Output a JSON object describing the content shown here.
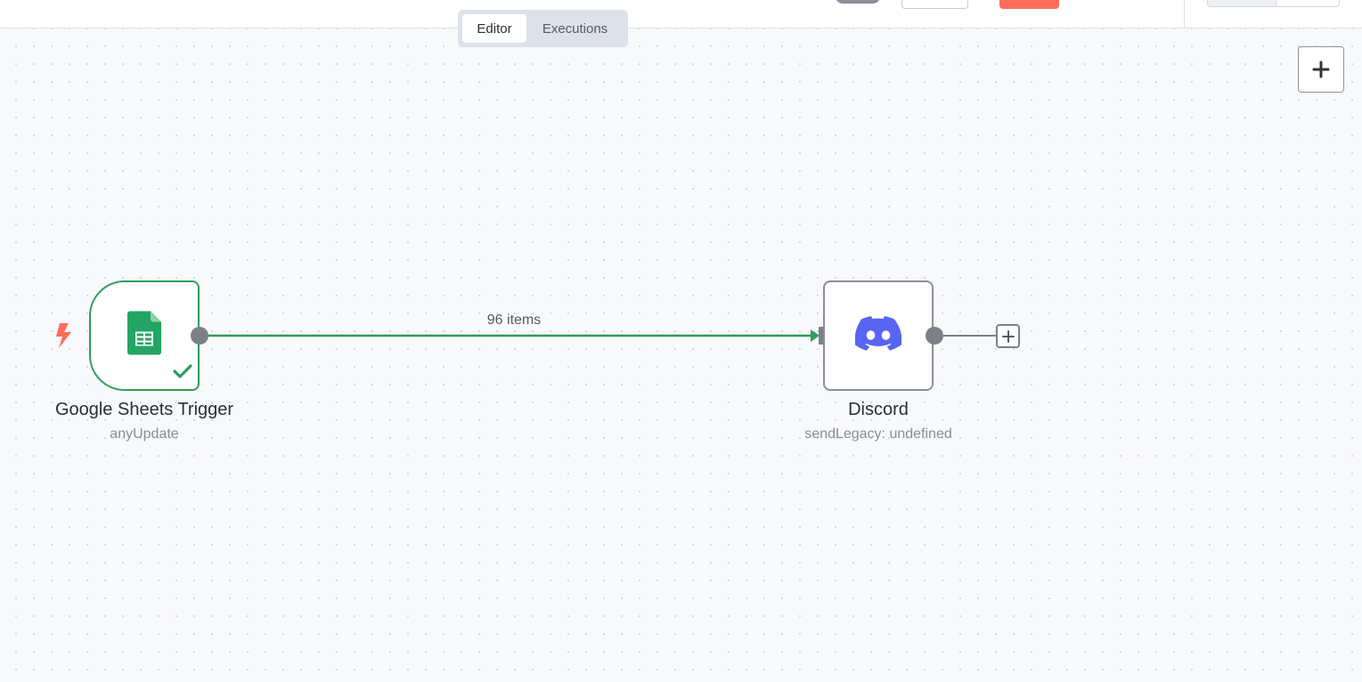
{
  "mode_toggle": {
    "editor_label": "Editor",
    "executions_label": "Executions",
    "active": "Editor"
  },
  "workflow": {
    "nodes": [
      {
        "id": "trigger",
        "title": "Google Sheets Trigger",
        "subtitle": "anyUpdate",
        "icon": "google-sheets-icon",
        "status": "success"
      },
      {
        "id": "discord",
        "title": "Discord",
        "subtitle": "sendLegacy: undefined",
        "icon": "discord-icon"
      }
    ],
    "connection": {
      "label": "96 items"
    }
  },
  "colors": {
    "success": "#2e9e5b",
    "trigger_bolt": "#ff6d5a",
    "discord": "#5865f2",
    "sheets": "#23a566"
  }
}
